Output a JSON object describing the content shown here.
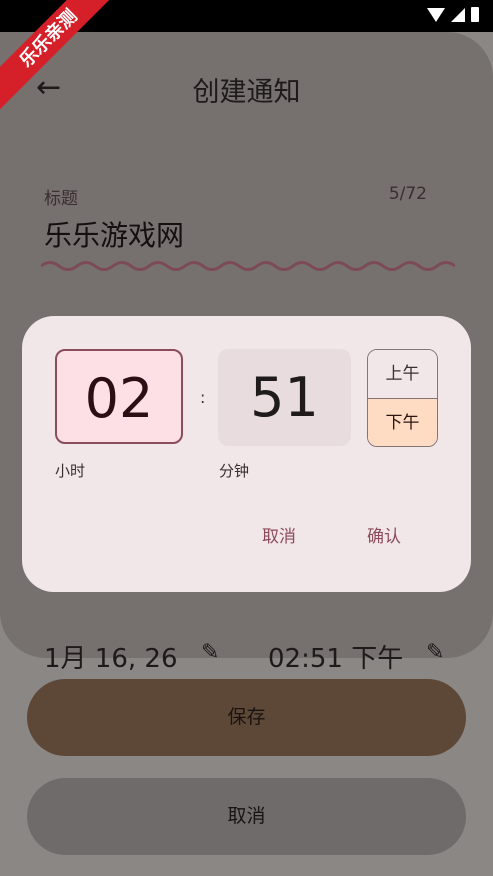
{
  "watermark": "乐乐亲测",
  "header": {
    "title": "创建通知"
  },
  "title_field": {
    "label": "标题",
    "counter": "5/72",
    "value": "乐乐游戏网"
  },
  "schedule": {
    "date": "1月 16, 26",
    "time": "02:51 下午"
  },
  "actions": {
    "save_label": "保存",
    "cancel_label": "取消"
  },
  "time_picker": {
    "hour": "02",
    "separator": ":",
    "minute": "51",
    "am_label": "上午",
    "pm_label": "下午",
    "selected_period": "下午",
    "hour_label": "小时",
    "minute_label": "分钟",
    "cancel_label": "取消",
    "confirm_label": "确认"
  },
  "icons": {
    "back": "back-arrow-icon",
    "edit": "pencil-icon"
  },
  "colors": {
    "accent": "#8c4a5a",
    "hour_bg": "#fde0e6",
    "pm_bg": "#fddcc3",
    "save_bg": "#5d4838"
  }
}
